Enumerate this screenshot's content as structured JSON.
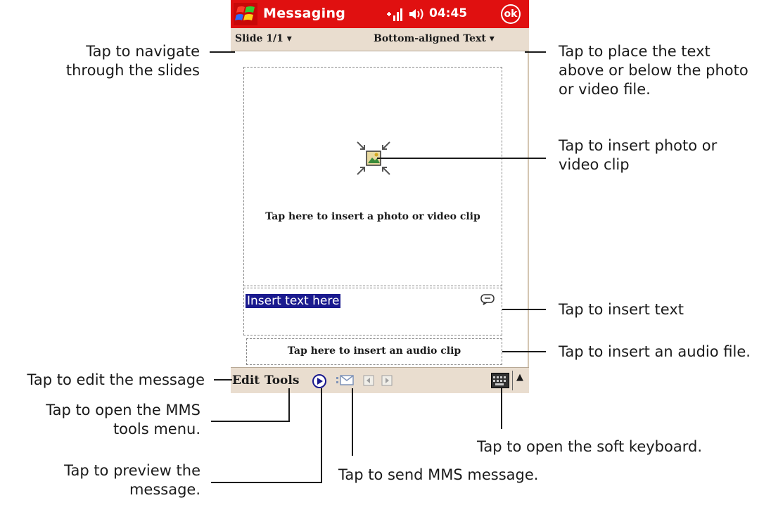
{
  "device": {
    "title": "Messaging",
    "clock": "04:45",
    "ok_label": "ok",
    "slide_label": "Slide 1/1 ▾",
    "layout_label": "Bottom-aligned Text ▾",
    "photo_prompt": "Tap here to insert a photo or video clip",
    "text_placeholder": "Insert text here",
    "audio_prompt": "Tap here to insert an audio clip",
    "menu": {
      "edit": "Edit",
      "tools": "Tools"
    }
  },
  "callouts": {
    "navigate": [
      "Tap to navigate",
      "through the slides"
    ],
    "place_text": [
      "Tap to place the text",
      "above or below the photo",
      "or video file."
    ],
    "insert_photo": [
      "Tap to insert photo or",
      "video clip"
    ],
    "insert_text": "Tap to insert text",
    "insert_audio": "Tap to insert an audio file.",
    "edit_message": "Tap to edit the message",
    "tools_menu": [
      "Tap to open the MMS",
      "tools menu."
    ],
    "preview": [
      "Tap to preview the",
      "message."
    ],
    "send": "Tap to send MMS message.",
    "keyboard": "Tap to open the soft keyboard."
  },
  "colors": {
    "titlebar": "#e01010",
    "bars": "#e9ddcf",
    "selection": "#1a1a8e"
  }
}
